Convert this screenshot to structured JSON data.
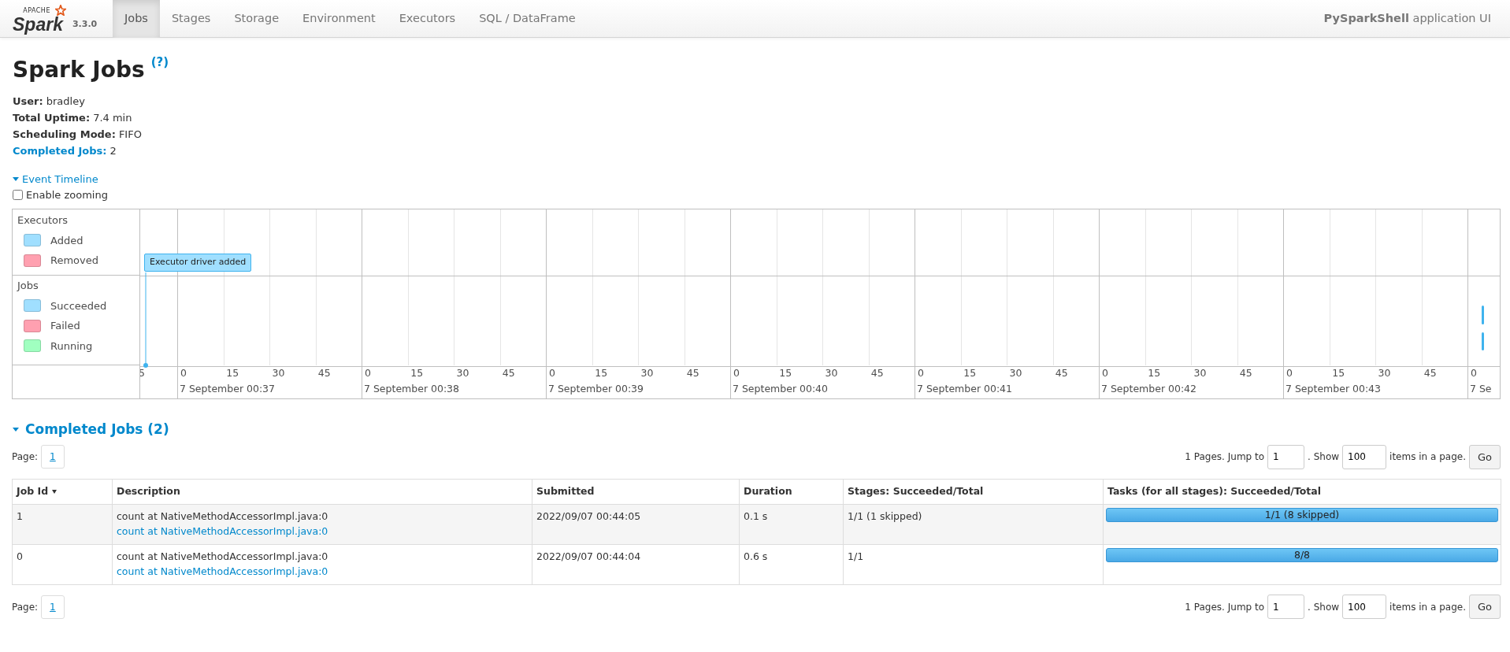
{
  "navbar": {
    "logo": {
      "small": "APACHE",
      "name": "Spark"
    },
    "version": "3.3.0",
    "tabs": [
      {
        "label": "Jobs",
        "selected": true
      },
      {
        "label": "Stages",
        "selected": false
      },
      {
        "label": "Storage",
        "selected": false
      },
      {
        "label": "Environment",
        "selected": false
      },
      {
        "label": "Executors",
        "selected": false
      },
      {
        "label": "SQL / DataFrame",
        "selected": false
      }
    ],
    "app_name": "PySparkShell",
    "app_suffix": "application UI"
  },
  "page_title": "Spark Jobs",
  "help_link": "(?)",
  "summary": [
    {
      "label": "User:",
      "value": "bradley",
      "kind": "plain"
    },
    {
      "label": "Total Uptime:",
      "value": "7.4 min",
      "kind": "plain"
    },
    {
      "label": "Scheduling Mode:",
      "value": "FIFO",
      "kind": "plain"
    },
    {
      "label": "Completed Jobs:",
      "value": "2",
      "kind": "link"
    }
  ],
  "event_timeline": {
    "label": "Event Timeline",
    "expanded": true
  },
  "zoom_toggle": {
    "label": "Enable zooming",
    "checked": false
  },
  "timeline": {
    "groups": [
      {
        "title": "Executors",
        "legend": [
          {
            "label": "Added",
            "color": "#a0dfff"
          },
          {
            "label": "Removed",
            "color": "#ffa0b0"
          }
        ]
      },
      {
        "title": "Jobs",
        "legend": [
          {
            "label": "Succeeded",
            "color": "#a0dfff"
          },
          {
            "label": "Failed",
            "color": "#ffa0b0"
          },
          {
            "label": "Running",
            "color": "#a0ffc0"
          }
        ]
      }
    ],
    "executor_event": "Executor driver added",
    "leading_tick": "5",
    "minutes": [
      {
        "ticks": [
          "0",
          "15",
          "30",
          "45"
        ],
        "label": "7 September 00:37"
      },
      {
        "ticks": [
          "0",
          "15",
          "30",
          "45"
        ],
        "label": "7 September 00:38"
      },
      {
        "ticks": [
          "0",
          "15",
          "30",
          "45"
        ],
        "label": "7 September 00:39"
      },
      {
        "ticks": [
          "0",
          "15",
          "30",
          "45"
        ],
        "label": "7 September 00:40"
      },
      {
        "ticks": [
          "0",
          "15",
          "30",
          "45"
        ],
        "label": "7 September 00:41"
      },
      {
        "ticks": [
          "0",
          "15",
          "30",
          "45"
        ],
        "label": "7 September 00:42"
      },
      {
        "ticks": [
          "0",
          "15",
          "30",
          "45"
        ],
        "label": "7 September 00:43"
      }
    ],
    "trailing": {
      "tick": "0",
      "label": "7 Se"
    }
  },
  "section": {
    "title": "Completed Jobs (2)",
    "expanded": true
  },
  "pagination_top": {
    "page_label": "Page:",
    "page": "1",
    "pages_text": "1 Pages. Jump to",
    "jump_value": "1",
    "show_text": ". Show",
    "show_value": "100",
    "items_text": "items in a page.",
    "go": "Go"
  },
  "table": {
    "columns": [
      {
        "label": "Job Id",
        "sorted": true
      },
      {
        "label": "Description",
        "sorted": false
      },
      {
        "label": "Submitted",
        "sorted": false
      },
      {
        "label": "Duration",
        "sorted": false
      },
      {
        "label": "Stages: Succeeded/Total",
        "sorted": false
      },
      {
        "label": "Tasks (for all stages): Succeeded/Total",
        "sorted": false
      }
    ],
    "rows": [
      {
        "job_id": "1",
        "description": "count at NativeMethodAccessorImpl.java:0",
        "link": "count at NativeMethodAccessorImpl.java:0",
        "submitted": "2022/09/07 00:44:05",
        "duration": "0.1 s",
        "stages": "1/1 (1 skipped)",
        "tasks": "1/1 (8 skipped)",
        "level": 1
      },
      {
        "job_id": "0",
        "description": "count at NativeMethodAccessorImpl.java:0",
        "link": "count at NativeMethodAccessorImpl.java:0",
        "submitted": "2022/09/07 00:44:04",
        "duration": "0.6 s",
        "stages": "1/1",
        "tasks": "8/8",
        "level": 1
      }
    ]
  },
  "pagination_bottom": {
    "page_label": "Page:",
    "page": "1",
    "pages_text": "1 Pages. Jump to",
    "jump_value": "1",
    "show_text": ". Show",
    "show_value": "100",
    "items_text": "items in a page.",
    "go": "Go"
  }
}
